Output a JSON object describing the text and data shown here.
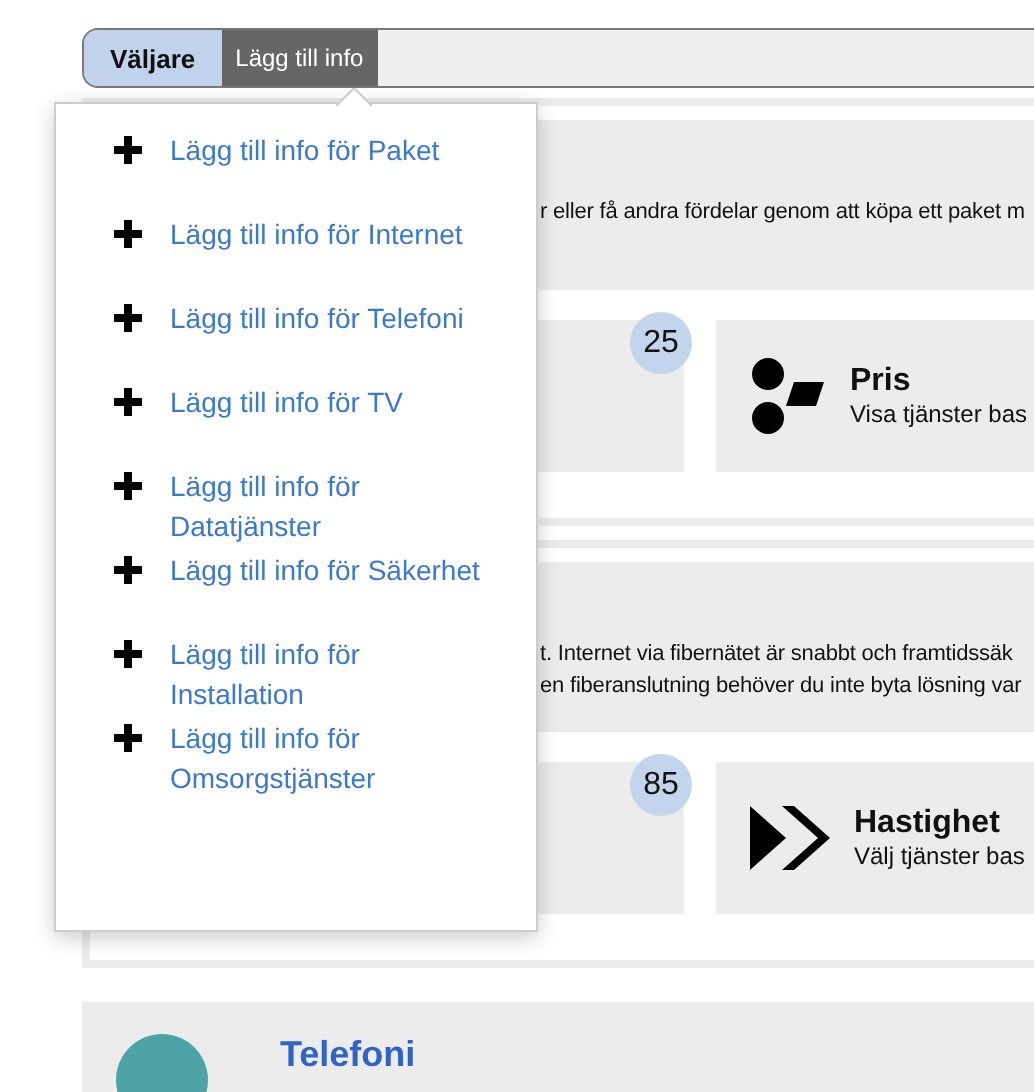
{
  "toolbar": {
    "title": "Väljare",
    "menu_button": {
      "label": "Lägg till info",
      "expanded": true
    }
  },
  "menu": {
    "items": [
      {
        "label": "Lägg till info för Paket"
      },
      {
        "label": "Lägg till info för Internet"
      },
      {
        "label": "Lägg till info för Telefoni"
      },
      {
        "label": "Lägg till info för TV"
      },
      {
        "label": "Lägg till info för Datatjänster"
      },
      {
        "label": "Lägg till info för Säkerhet"
      },
      {
        "label": "Lägg till info för Installation"
      },
      {
        "label": "Lägg till info för Omsorgstjänster"
      }
    ]
  },
  "sections": [
    {
      "description": [
        "r eller få andra fördelar genom att köpa ett paket m"
      ],
      "count": "25",
      "filter": {
        "kind": "price",
        "title": "Pris",
        "subtitle": "Visa tjänster bas"
      }
    },
    {
      "description": [
        "t. Internet via fibernätet är snabbt och framtidssäk",
        "en fiberanslutning behöver du inte byta lösning var"
      ],
      "count": "85",
      "filter": {
        "kind": "speed",
        "title": "Hastighet",
        "subtitle": "Välj tjänster bas"
      }
    }
  ],
  "next_section": {
    "title": "Telefoni"
  }
}
